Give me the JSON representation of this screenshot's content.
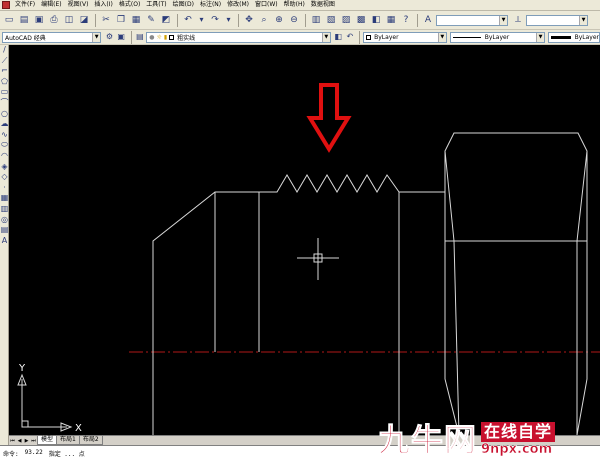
{
  "menubar": {
    "items": [
      "文件(F)",
      "编辑(E)",
      "视图(V)",
      "插入(I)",
      "格式(O)",
      "工具(T)",
      "绘图(D)",
      "标注(N)",
      "修改(M)",
      "窗口(W)",
      "帮助(H)",
      "数据视图"
    ]
  },
  "toolbar2": {
    "workspace": "AutoCAD 经典",
    "layer": "粗实线",
    "color": "ByLayer",
    "linetype": "ByLayer",
    "lineweight": "ByLayer"
  },
  "ucs": {
    "x_label": "X",
    "y_label": "Y"
  },
  "tabs": {
    "items": [
      "模型",
      "布局1",
      "布局2"
    ],
    "active": 0
  },
  "command_line": {
    "prompt": "命令:",
    "coords": "93.22",
    "status": "指定 ... 点"
  },
  "watermark": {
    "brand": "九牛网",
    "slogan": "在线自学",
    "url": "9npx.com"
  },
  "colors": {
    "canvas": "#000000",
    "drawing_lines": "#d9d9d9",
    "centerline": "#b01818",
    "arrow": "#e01010",
    "brand_red": "#c8102e"
  },
  "icons": {
    "file_new": "new-file-icon",
    "open": "open-folder-icon",
    "save": "save-icon",
    "print": "print-icon",
    "preview": "print-preview-icon",
    "cut": "cut-icon",
    "copy": "copy-icon",
    "paste": "paste-icon",
    "match": "match-properties-icon",
    "undo": "undo-icon",
    "redo": "redo-icon",
    "pan": "pan-icon",
    "zoom": "zoom-icon",
    "properties": "properties-icon",
    "layer": "layer-manager-icon"
  }
}
